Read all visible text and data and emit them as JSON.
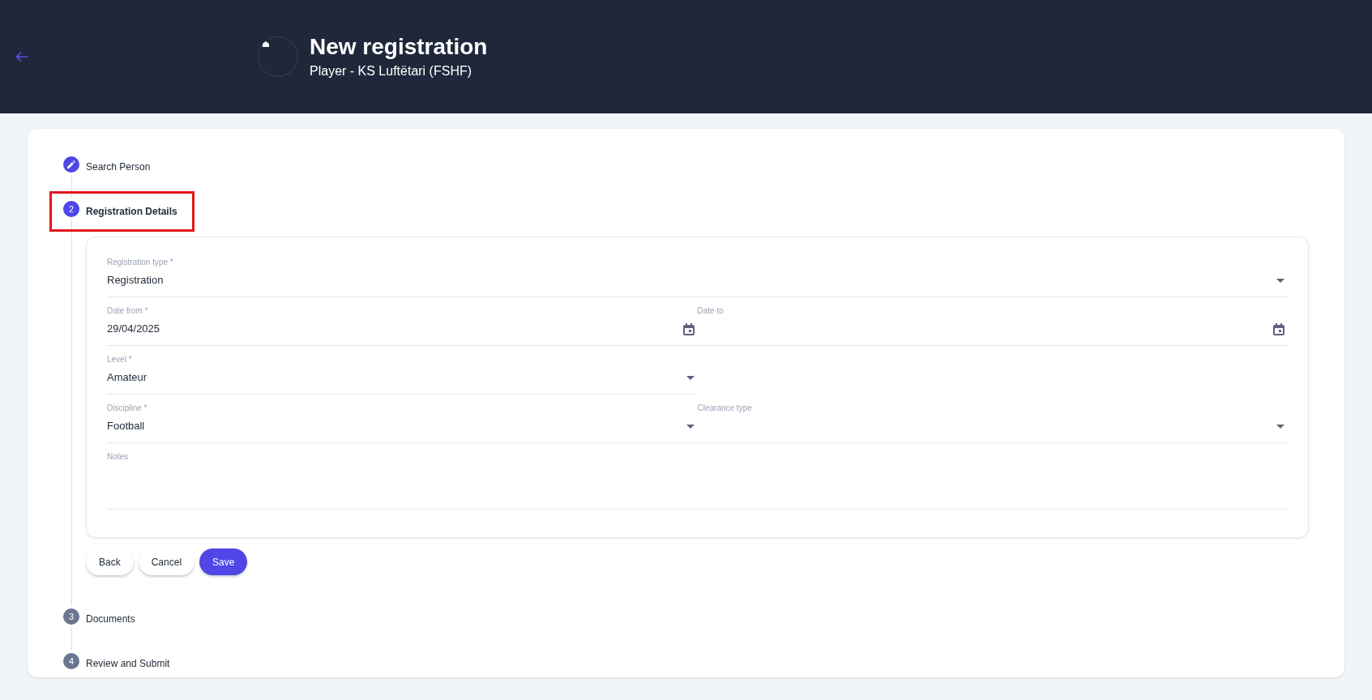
{
  "header": {
    "title": "New registration",
    "subtitle": "Player - KS Luftëtari (FSHF)"
  },
  "steps": [
    {
      "kind": "done",
      "label": "Search Person",
      "highlighted": false
    },
    {
      "kind": "active",
      "number": "2",
      "label": "Registration Details",
      "highlighted": true
    },
    {
      "kind": "pending",
      "number": "3",
      "label": "Documents",
      "highlighted": false
    },
    {
      "kind": "pending",
      "number": "4",
      "label": "Review and Submit",
      "highlighted": false
    }
  ],
  "form": {
    "rows": [
      [
        {
          "kind": "select",
          "label": "Registration type *",
          "value": "Registration"
        }
      ],
      [
        {
          "kind": "date",
          "label": "Date from *",
          "value": "29/04/2025"
        },
        {
          "kind": "date",
          "label": "Date to"
        }
      ],
      [
        {
          "kind": "select",
          "label": "Level *",
          "value": "Amateur"
        },
        {
          "kind": "empty"
        }
      ],
      [
        {
          "kind": "select",
          "label": "Discipline *",
          "value": "Football"
        },
        {
          "kind": "select",
          "label": "Clearance type"
        }
      ],
      [
        {
          "kind": "textarea",
          "label": "Notes"
        }
      ]
    ]
  },
  "buttons": [
    {
      "label": "Back",
      "primary": false
    },
    {
      "label": "Cancel",
      "primary": false
    },
    {
      "label": "Save",
      "primary": true
    }
  ]
}
